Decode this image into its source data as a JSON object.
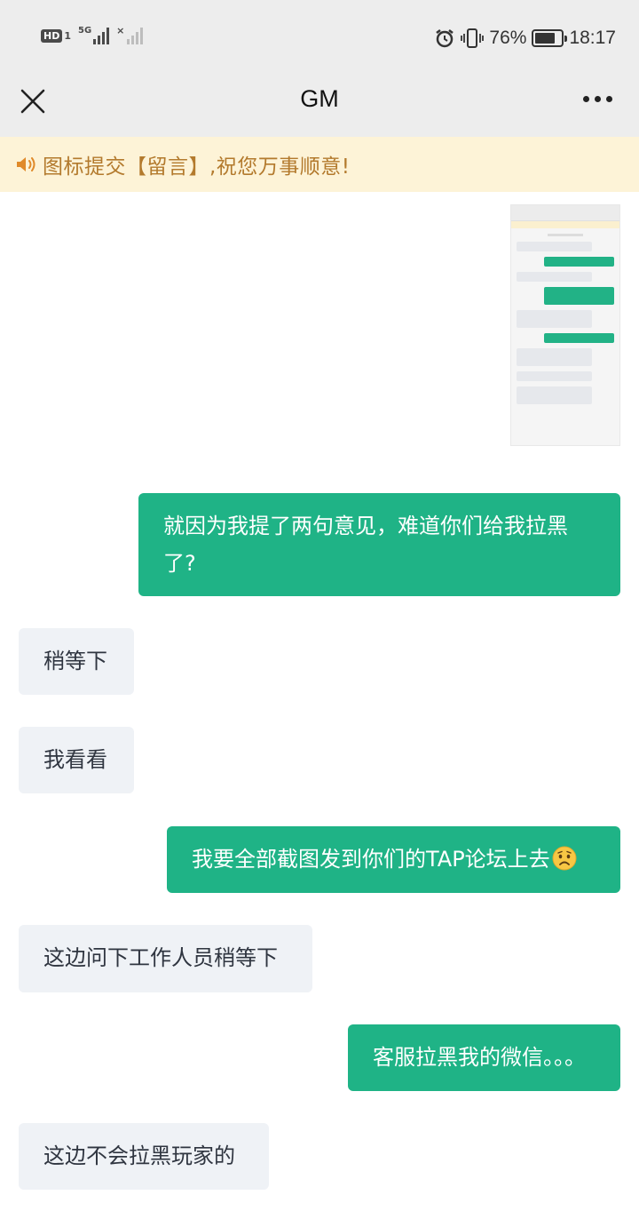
{
  "status_bar": {
    "hd_label": "HD",
    "hd_sim": "1",
    "network_label": "5G",
    "battery_percent": "76%",
    "battery_level": 0.76,
    "time": "18:17",
    "icons": [
      "hd-icon",
      "signal-5g-icon",
      "signal-weak-icon",
      "alarm-icon",
      "vibrate-icon",
      "battery-icon"
    ]
  },
  "nav": {
    "title": "GM",
    "close_icon": "close-icon",
    "more_icon": "more-icon"
  },
  "notice": {
    "icon": "speaker-icon",
    "text": "图标提交【留言】,祝您万事顺意!"
  },
  "colors": {
    "outgoing_bubble": "#1fb386",
    "incoming_bubble": "#eff2f6",
    "notice_bg": "#fdf3d7",
    "notice_text": "#b37a2d",
    "bar_bg": "#ededed"
  },
  "messages": [
    {
      "direction": "out",
      "type": "image",
      "alt_icon": "screenshot-thumbnail"
    },
    {
      "direction": "out",
      "text": "就因为我提了两句意见，难道你们给我拉黑了?"
    },
    {
      "direction": "in",
      "text": "稍等下"
    },
    {
      "direction": "in",
      "text": "我看看"
    },
    {
      "direction": "out",
      "text": "我要全部截图发到你们的TAP论坛上去",
      "emoji": "worried-face-icon"
    },
    {
      "direction": "in",
      "text": "这边问下工作人员稍等下"
    },
    {
      "direction": "out",
      "text": "客服拉黑我的微信。。。"
    },
    {
      "direction": "in",
      "text": "这边不会拉黑玩家的"
    }
  ]
}
